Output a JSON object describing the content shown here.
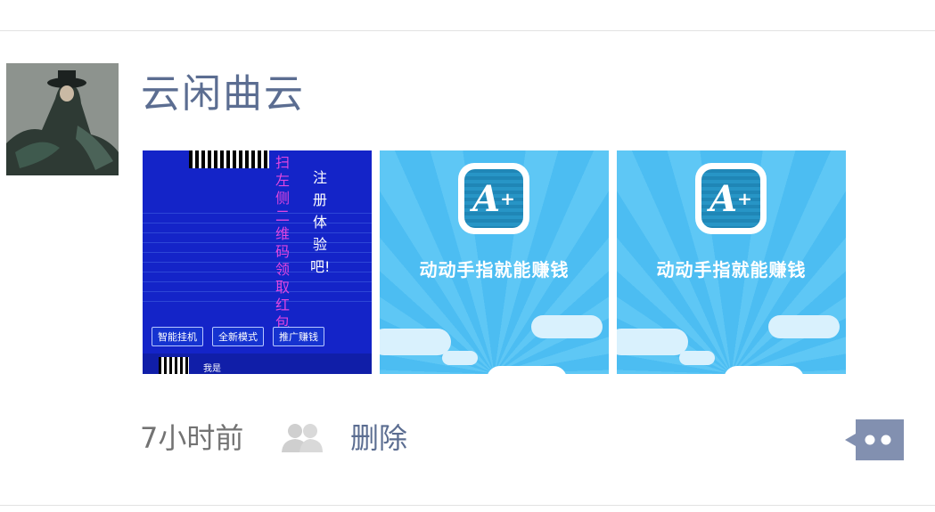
{
  "post": {
    "author_name": "云闲曲云",
    "time": "7小时前",
    "delete_label": "删除",
    "photos": [
      {
        "type": "game-ad",
        "vertical_text_pink": "扫左侧二维码领取红包",
        "vertical_text_white": "注册体验吧!",
        "buttons": [
          "智能挂机",
          "全新模式",
          "推广赚钱"
        ],
        "footer_text": "我是"
      },
      {
        "type": "app-promo",
        "icon_label": "A",
        "promo_text": "动动手指就能赚钱"
      },
      {
        "type": "app-promo",
        "icon_label": "A",
        "promo_text": "动动手指就能赚钱"
      }
    ]
  },
  "icons": {
    "privacy": "friends-icon",
    "comment": "comment-icon"
  },
  "colors": {
    "name_link": "#5b6d91",
    "time_text": "#737373",
    "comment_button": "#8290b0",
    "promo_sky": "#4cbdf2",
    "game_blue": "#1424c8"
  }
}
